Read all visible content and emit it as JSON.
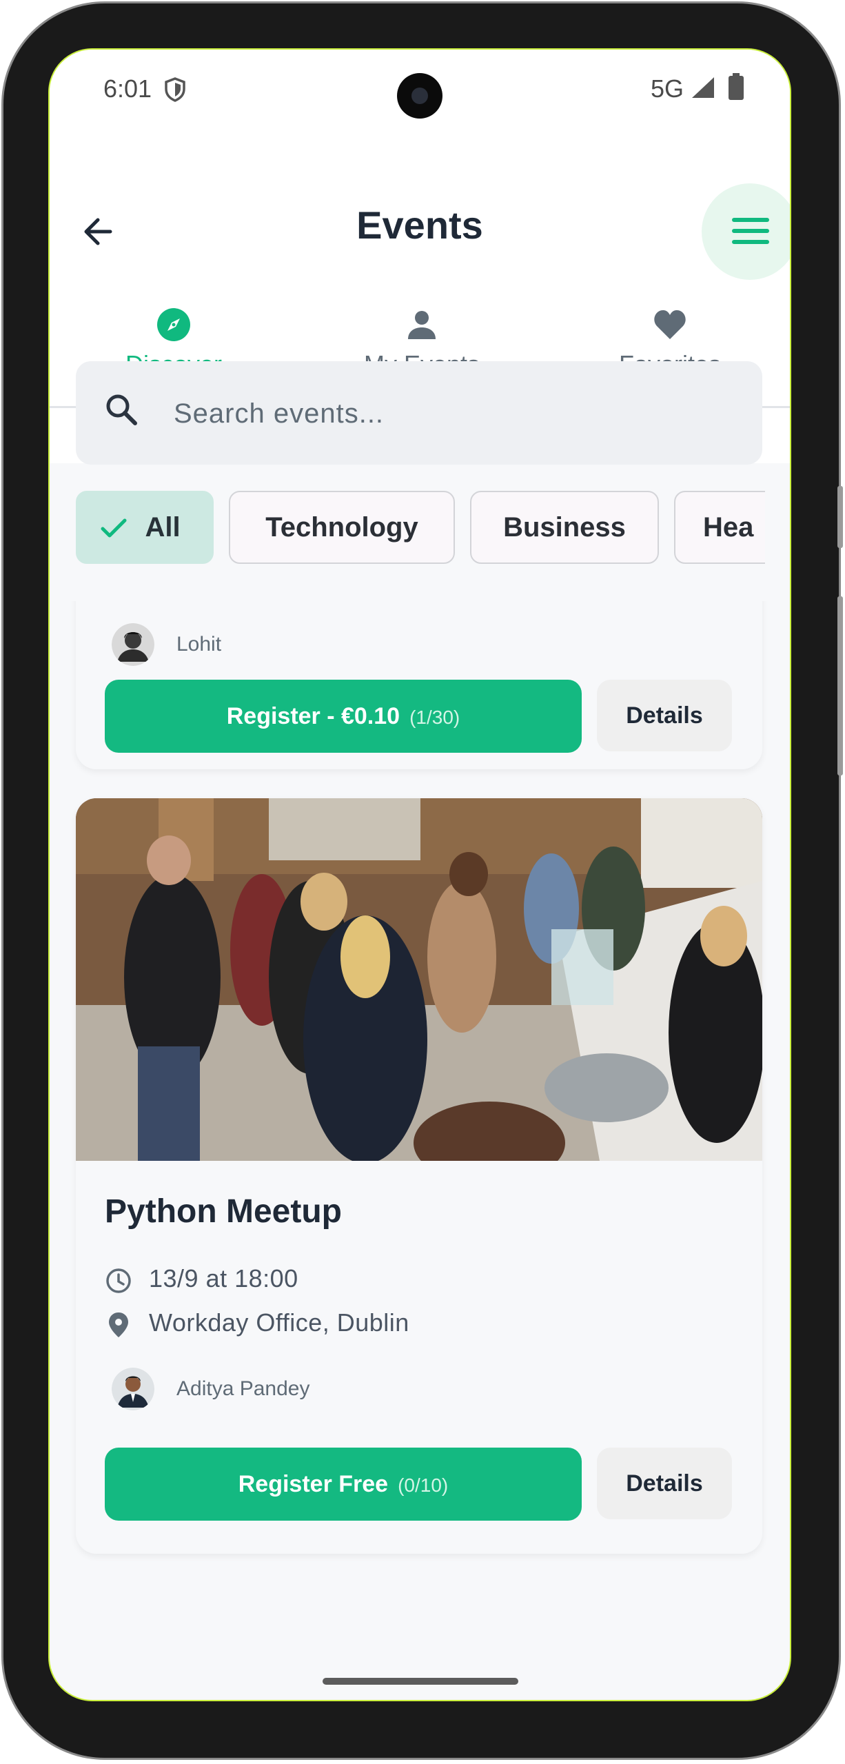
{
  "status_bar": {
    "time": "6:01",
    "network": "5G"
  },
  "header": {
    "title": "Events"
  },
  "tabs": [
    {
      "label": "Discover",
      "icon": "compass-icon",
      "active": true
    },
    {
      "label": "My Events",
      "icon": "person-icon",
      "active": false
    },
    {
      "label": "Favorites",
      "icon": "heart-icon",
      "active": false
    }
  ],
  "search": {
    "placeholder": "Search events..."
  },
  "filters": [
    {
      "label": "All",
      "active": true
    },
    {
      "label": "Technology",
      "active": false
    },
    {
      "label": "Business",
      "active": false
    },
    {
      "label": "Hea",
      "active": false
    }
  ],
  "events": [
    {
      "organizer": "Lohit",
      "register_label": "Register - €0.10",
      "register_count": "(1/30)",
      "details_label": "Details"
    },
    {
      "title": "Python Meetup",
      "datetime": "13/9 at 18:00",
      "location": "Workday Office, Dublin",
      "organizer": "Aditya Pandey",
      "register_label": "Register Free",
      "register_count": "(0/10)",
      "details_label": "Details"
    }
  ],
  "colors": {
    "accent": "#10b97f",
    "title": "#1f2937",
    "muted": "#5f6b76"
  }
}
